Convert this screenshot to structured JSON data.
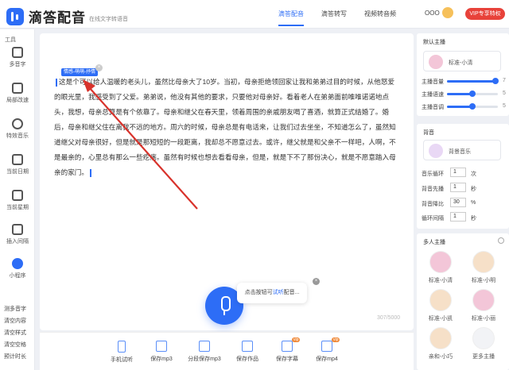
{
  "header": {
    "title": "滴答配音",
    "subtitle": "在线文字转语音",
    "nav": [
      "滴答配音",
      "滴答转写",
      "视频转音频"
    ],
    "user_name": "OOO",
    "vip_label": "VIP专享特权"
  },
  "sidebar": {
    "title": "工具",
    "tools": [
      {
        "label": "多音字",
        "icon": "text-icon"
      },
      {
        "label": "局部改速",
        "icon": "speed-icon"
      },
      {
        "label": "特效音乐",
        "icon": "music-icon"
      },
      {
        "label": "当前日期",
        "icon": "calendar-icon"
      },
      {
        "label": "当前星期",
        "icon": "week-icon"
      },
      {
        "label": "插入间隔",
        "icon": "interval-icon"
      },
      {
        "label": "小程序",
        "icon": "miniprogram-icon"
      }
    ],
    "list": [
      "测多音字",
      "清空内容",
      "清空样式",
      "清空空格",
      "预计时长"
    ]
  },
  "editor": {
    "tag": "情感-萌萌-抒情",
    "tag_close": "×",
    "text": "这是个可以给人温暖的老头儿，虽然比母亲大了10岁。当初，母亲拒绝领回家让我和弟弟过目的时候，从他怒爱的眼光里，我感受到了父爱。弟弟说，他没有其他的要求，只要他对母亲好。看着老人在弟弟面前唯唯诺诺地点头，我想，母亲总算是有个依靠了。母亲和继父在春天里，领着周围的亲戚朋友喝了喜酒，就算正式结婚了。婚后，母亲和继父住在离我不远的地方。周六的时候，母亲总是有电话来，让我们过去坐坐，不知道怎么了，虽然知道继父对母亲很好，但是就是那短短的一段距离，我却总不愿意过去。或许，继父就是和父亲不一样吧，人啊，不是最亲的，心里总有那么一些疙瘩。虽然有时候也想去看看母亲，但是，就是下不了那份决心，就是不愿意踏入母亲的家门。",
    "counter": "307/5000",
    "tip_before": "点击按钮可",
    "tip_highlight": "试听",
    "tip_after": "配音...",
    "tip_close": "×"
  },
  "toolbar": [
    {
      "label": "手机试听",
      "icon": "phone-icon",
      "vip": false
    },
    {
      "label": "保存mp3",
      "icon": "mp3-icon",
      "vip": false
    },
    {
      "label": "分段保存mp3",
      "icon": "segment-mp3-icon",
      "vip": false
    },
    {
      "label": "保存作品",
      "icon": "save-work-icon",
      "vip": false
    },
    {
      "label": "保存字幕",
      "icon": "subtitle-icon",
      "vip": true
    },
    {
      "label": "保存mp4",
      "icon": "mp4-icon",
      "vip": true
    }
  ],
  "toolbar_vip_badge": "vip",
  "right": {
    "anchor_title": "默认主播",
    "anchor_name": "标准-小清",
    "sliders": [
      {
        "label": "主播音量",
        "value": 7,
        "fraction": 0.95
      },
      {
        "label": "主播语速",
        "value": 5,
        "fraction": 0.5
      },
      {
        "label": "主播音调",
        "value": 5,
        "fraction": 0.5
      }
    ],
    "bgm_title": "背音",
    "bgm_name": "背景音乐",
    "bgm_rows": [
      {
        "label": "音乐循环",
        "value": "1",
        "unit": "次"
      },
      {
        "label": "背音先播",
        "value": "1",
        "unit": "秒"
      },
      {
        "label": "背音降比",
        "value": "30",
        "unit": "%"
      },
      {
        "label": "循环间隔",
        "value": "1",
        "unit": "秒"
      }
    ],
    "multi_title": "多人主播",
    "speakers": [
      "标准-小清",
      "标准-小明",
      "标准-小凯",
      "标准-小丽",
      "亲和-小巧",
      "更多主播"
    ]
  },
  "colors": {
    "accent": "#2d6df6",
    "vip": "#e8423a"
  }
}
